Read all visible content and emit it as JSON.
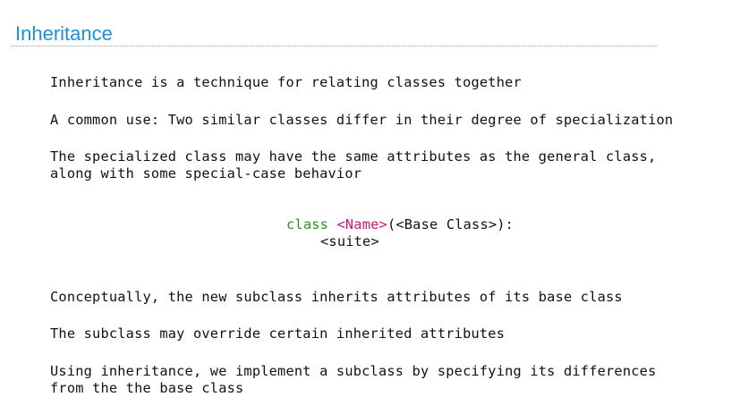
{
  "slide": {
    "title": "Inheritance",
    "paragraphs": {
      "p1": "Inheritance is a technique for relating classes together",
      "p2": "A common use: Two similar classes differ in their degree of specialization",
      "p3": "The specialized class may have the same attributes as the general class,\nalong with some special-case behavior",
      "p4": "Conceptually, the new subclass inherits attributes of its base class",
      "p5": "The subclass may override certain inherited attributes",
      "p6": "Using inheritance, we implement a subclass by specifying its differences\nfrom the the base class"
    },
    "code": {
      "keyword": "class",
      "name": "<Name>",
      "rest": "(<Base Class>):",
      "suite": "<suite>"
    }
  },
  "colors": {
    "title": "#1f8fd6",
    "keyword": "#2e8b2e",
    "name": "#c2187a",
    "text": "#111111"
  }
}
